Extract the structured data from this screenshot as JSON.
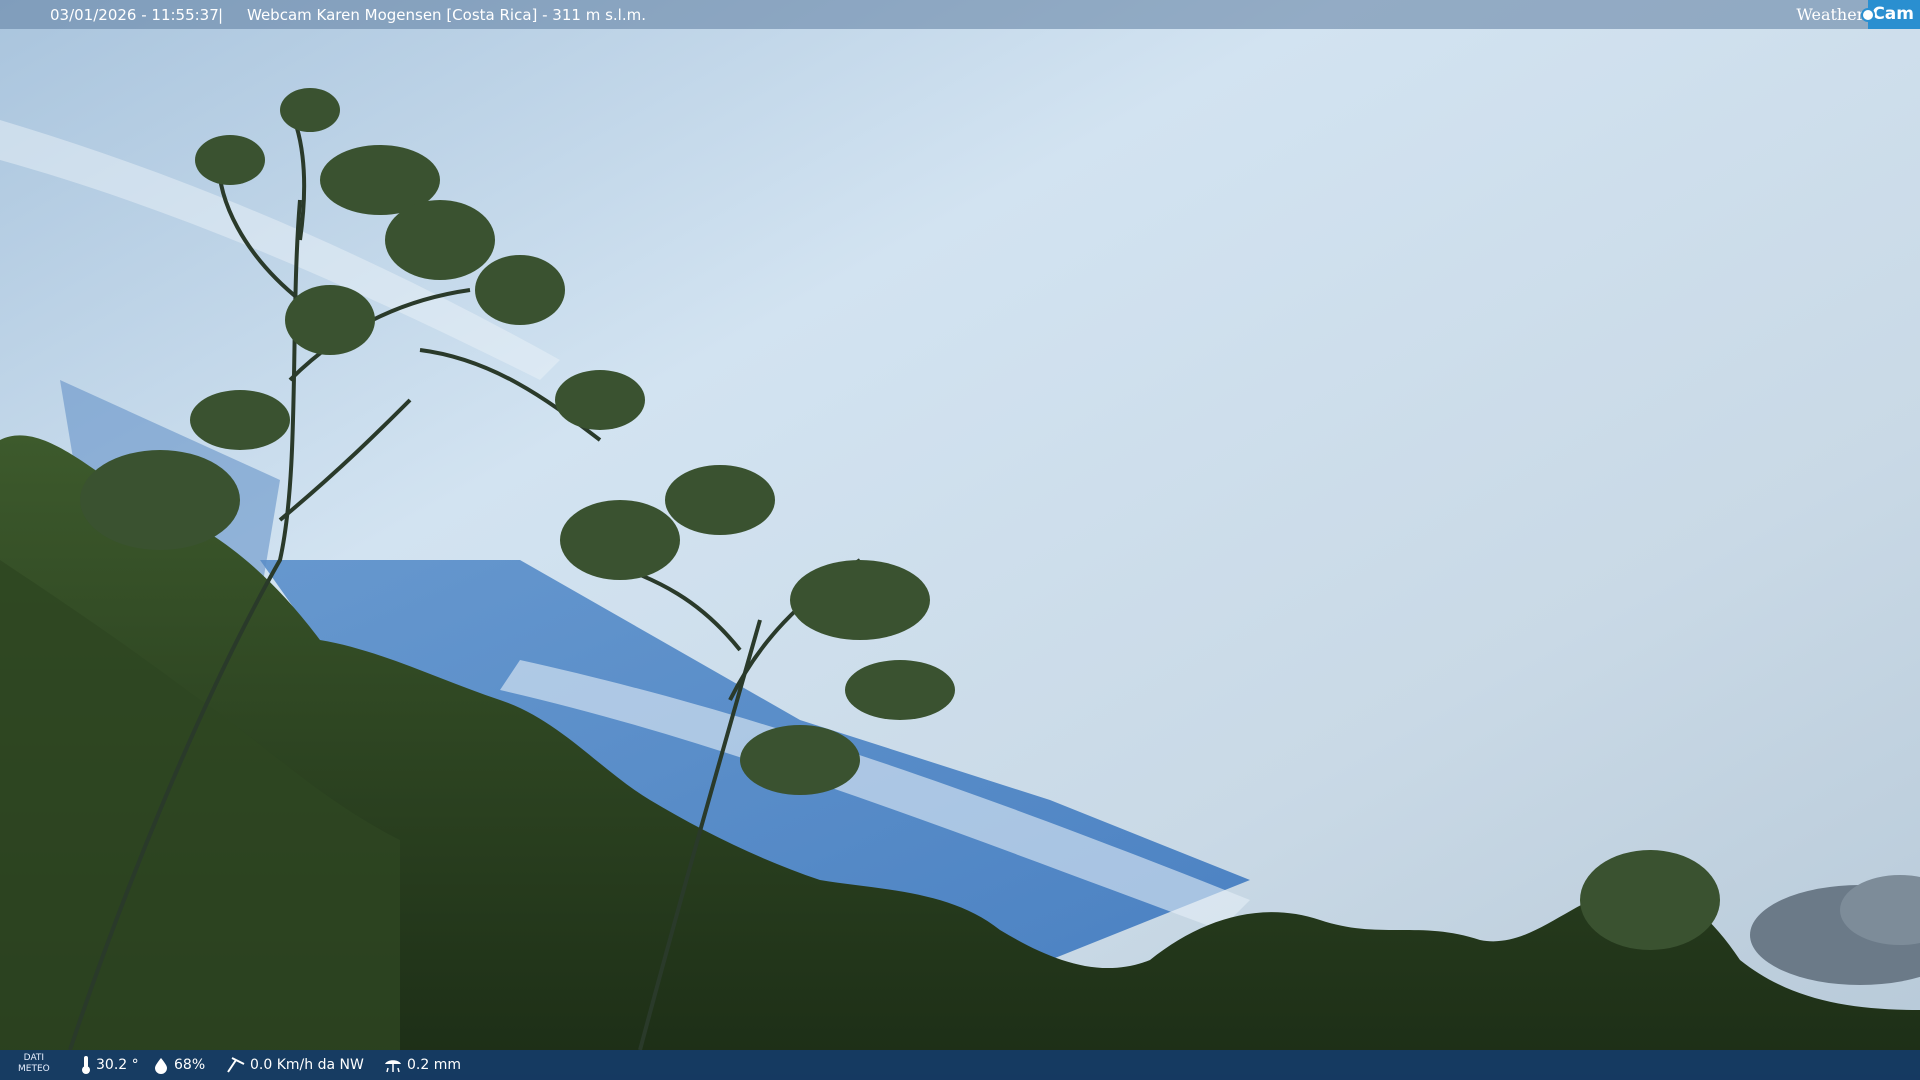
{
  "header": {
    "timestamp": "03/01/2026 - 11:55:37",
    "separator": "|",
    "camera_title": "Webcam Karen Mogensen [Costa Rica] - 311 m s.l.m."
  },
  "logo": {
    "word1": "Weather",
    "word2": "Cam",
    "accent_color": "#2a8fd0"
  },
  "weather_bar": {
    "label_line1": "DATI",
    "label_line2": "METEO",
    "temperature": "30.2 °",
    "humidity": "68%",
    "wind": "0.0 Km/h da NW",
    "rain": "0.2 mm",
    "icons": [
      "thermometer-icon",
      "humidity-drop-icon",
      "wind-icon",
      "rain-gauge-icon"
    ]
  },
  "colors": {
    "sky_top": "#b9d3ea",
    "sky_blue": "#3f7fc4",
    "foliage": "#243a1c"
  }
}
